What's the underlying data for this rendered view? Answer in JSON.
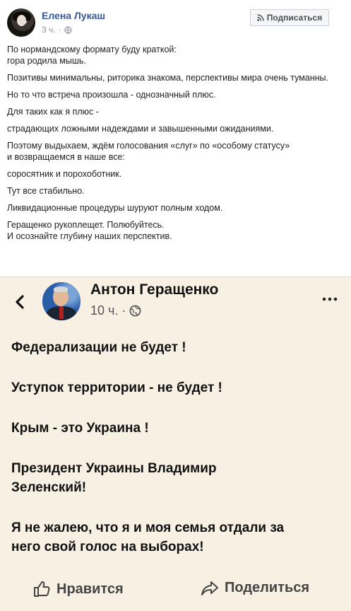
{
  "post": {
    "author": "Елена Лукаш",
    "time": "3 ч.",
    "dot": "·",
    "subscribe_label": "Подписаться",
    "paragraphs": [
      "По нормандскому формату буду краткой:",
      "гора родила мышь.",
      "Позитивы минимальны, риторика знакома, перспективы мира очень туманны.",
      "Но то что встреча произошла - однозначный плюс.",
      "Для таких как я плюс -",
      "страдающих ложными надеждами и завышенными ожиданиями.",
      "Поэтому выдыхаем, ждём голосования «слуг» по «особому статусу»",
      "и возвращаемся в наше все:",
      "соросятник и порохоботник.",
      "Тут все стабильно.",
      "Ликвидационные процедуры шуруют полным ходом.",
      "Геращенко рукоплещет. Полюбуйтесь.",
      "И осознайте глубину наших перспектив."
    ]
  },
  "embed": {
    "author": "Антон Геращенко",
    "time": "10 ч.",
    "dot": "·",
    "lines": [
      "Федерализации не будет !",
      "Уступок территории - не будет !",
      "Крым - это Украина !",
      "Президент Украины Владимир",
      "Зеленский!",
      "Я не жалею, что я и моя семья отдали за",
      "него свой голос на выборах!"
    ],
    "like_label": "Нравится",
    "share_label": "Поделиться"
  },
  "icons": {
    "globe": "globe-icon",
    "rss": "rss-icon",
    "back": "chevron-left-icon",
    "more": "more-icon",
    "like": "thumbs-up-icon",
    "share": "share-arrow-icon"
  },
  "colors": {
    "author_link": "#385898",
    "embed_bg": "#f8f0e3"
  }
}
